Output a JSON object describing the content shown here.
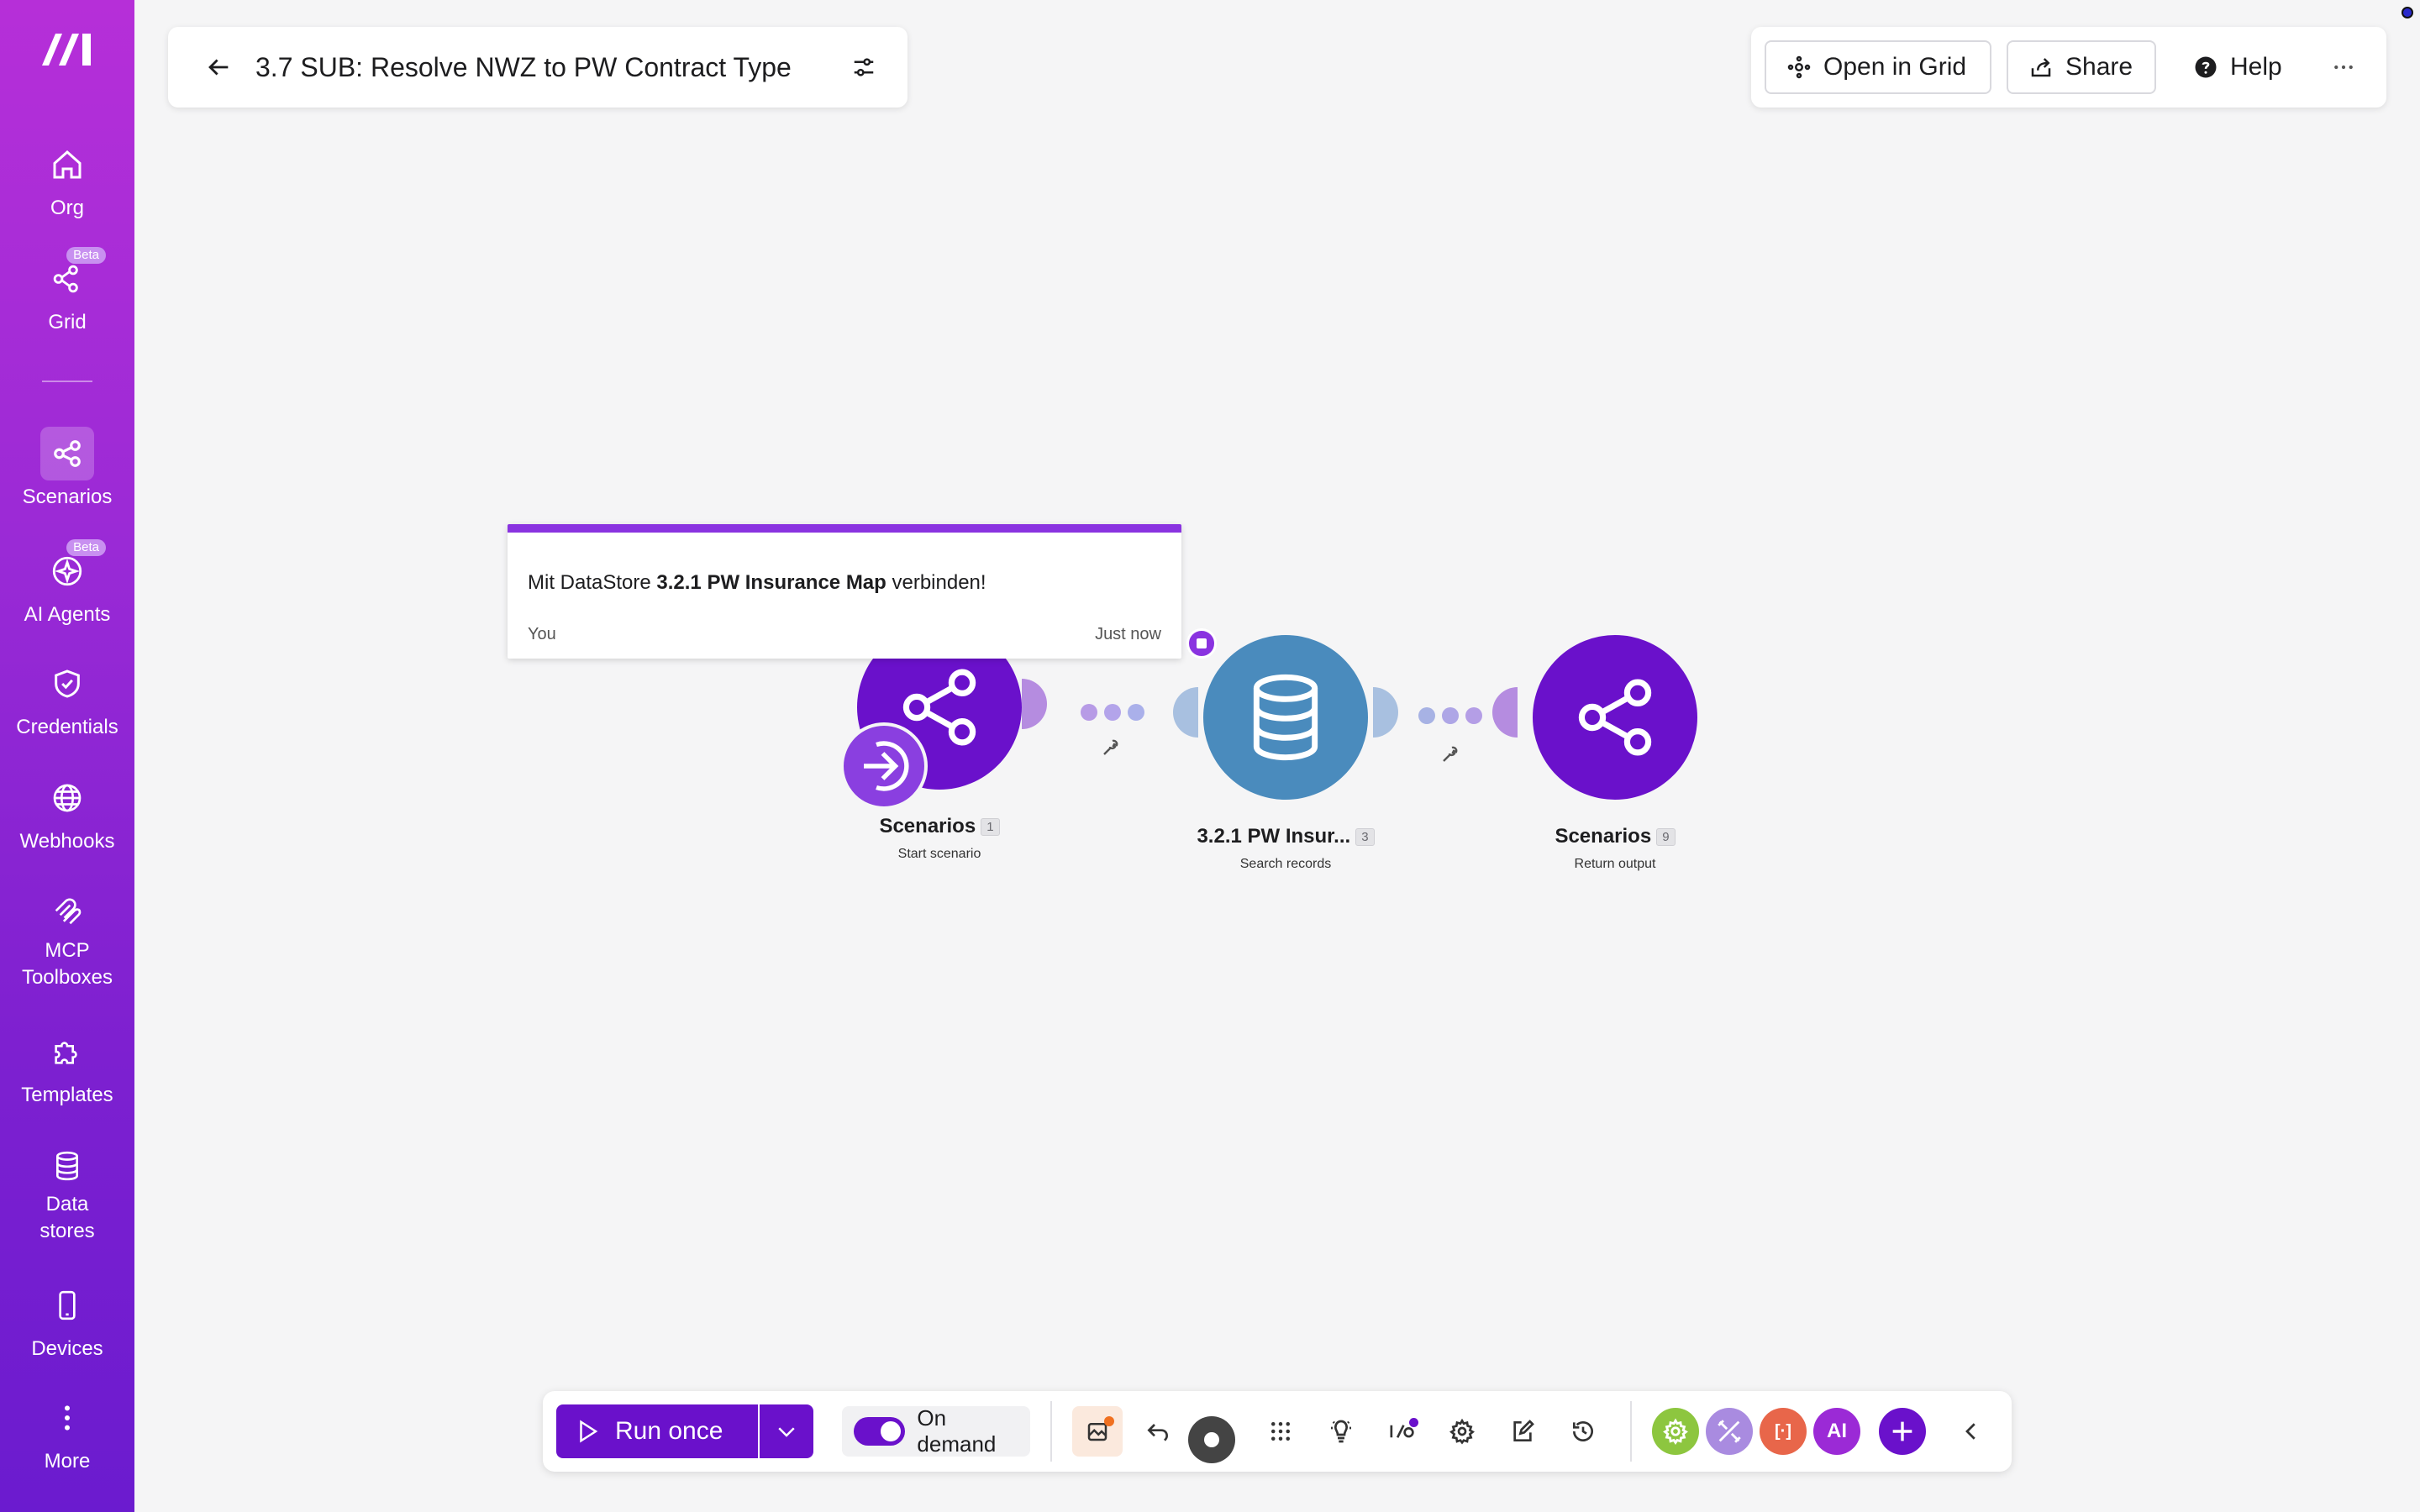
{
  "colors": {
    "brand": "#8a2be2",
    "run_button": "#6a11cb",
    "scenario_node": "#6a11cb",
    "datastore_node": "#4a8bbd",
    "note_border": "#8a33e0"
  },
  "sidebar": {
    "items": [
      {
        "label": "Org",
        "icon": "home-icon"
      },
      {
        "label": "Grid",
        "icon": "grid-network-icon",
        "badge": "Beta"
      },
      {
        "label": "Scenarios",
        "icon": "share-nodes-icon",
        "active": true
      },
      {
        "label": "AI Agents",
        "icon": "sparkle-icon",
        "badge": "Beta"
      },
      {
        "label": "Credentials",
        "icon": "shield-check-icon"
      },
      {
        "label": "Webhooks",
        "icon": "globe-icon"
      },
      {
        "label": "MCP\nToolboxes",
        "icon": "mcp-icon"
      },
      {
        "label": "Templates",
        "icon": "puzzle-icon"
      },
      {
        "label": "Data\nstores",
        "icon": "database-icon"
      },
      {
        "label": "Devices",
        "icon": "phone-icon"
      },
      {
        "label": "More",
        "icon": "vertical-dots-icon"
      }
    ]
  },
  "header": {
    "title": "3.7 SUB: Resolve NWZ to PW Contract Type",
    "open_in_grid": "Open in Grid",
    "share": "Share",
    "help": "Help"
  },
  "note": {
    "text_prefix": "Mit DataStore ",
    "text_bold": "3.2.1 PW Insurance Map",
    "text_suffix": " verbinden!",
    "author": "You",
    "time": "Just now"
  },
  "nodes": [
    {
      "name": "Scenarios",
      "count": "1",
      "subtitle": "Start scenario"
    },
    {
      "name": "3.2.1 PW Insur...",
      "count": "3",
      "subtitle": "Search records"
    },
    {
      "name": "Scenarios",
      "count": "9",
      "subtitle": "Return output"
    }
  ],
  "toolbar": {
    "run_once": "Run once",
    "schedule": "On demand",
    "avatars": [
      {
        "label": "",
        "color": "#8dc63f",
        "icon": "gear-icon"
      },
      {
        "label": "",
        "color": "#a98be0",
        "icon": "tools-icon"
      },
      {
        "label": "[·]",
        "color": "#e8664a",
        "icon": "bracket-icon"
      },
      {
        "label": "AI",
        "color": "#9b2ad6",
        "icon": "ai-icon"
      }
    ]
  }
}
